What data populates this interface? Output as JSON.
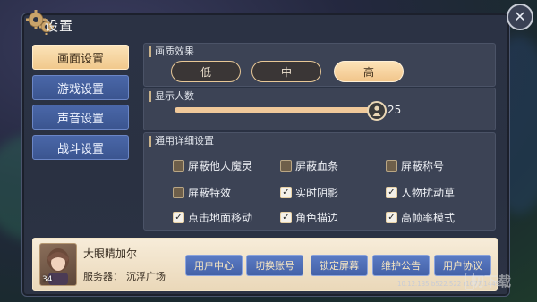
{
  "window": {
    "title": "设置"
  },
  "nav": {
    "items": [
      {
        "label": "画面设置",
        "active": true
      },
      {
        "label": "游戏设置",
        "active": false
      },
      {
        "label": "声音设置",
        "active": false
      },
      {
        "label": "战斗设置",
        "active": false
      }
    ]
  },
  "quality": {
    "heading": "画质效果",
    "options": [
      {
        "label": "低",
        "selected": false
      },
      {
        "label": "中",
        "selected": false
      },
      {
        "label": "高",
        "selected": true
      }
    ]
  },
  "display_count": {
    "heading": "显示人数",
    "value": "25",
    "fill_fraction": 1.0
  },
  "details": {
    "heading": "通用详细设置",
    "options": [
      {
        "label": "屏蔽他人魔灵",
        "checked": false
      },
      {
        "label": "屏蔽血条",
        "checked": false
      },
      {
        "label": "屏蔽称号",
        "checked": false
      },
      {
        "label": "屏蔽特效",
        "checked": false
      },
      {
        "label": "实时阴影",
        "checked": true
      },
      {
        "label": "人物扰动草",
        "checked": true
      },
      {
        "label": "点击地面移动",
        "checked": true
      },
      {
        "label": "角色描边",
        "checked": true
      },
      {
        "label": "高帧率模式",
        "checked": true
      }
    ]
  },
  "player": {
    "name": "大眼睛加尔",
    "level": "34",
    "server_label": "服务器：",
    "server_name": "沉浮广场"
  },
  "actions": [
    {
      "label": "用户中心"
    },
    {
      "label": "切换账号"
    },
    {
      "label": "锁定屏幕"
    },
    {
      "label": "维护公告"
    },
    {
      "label": "用户协议"
    }
  ],
  "version": "10.12.135 b522.522 r1077.1449",
  "watermark": "叨下载",
  "icons": {
    "settings": "gear-icon",
    "close": "close-icon",
    "slider": "person-icon",
    "check": "checkmark-icon"
  },
  "colors": {
    "accent": "#f1c98c",
    "nav_blue": "#4a67a8",
    "panel": "#2b3244"
  }
}
